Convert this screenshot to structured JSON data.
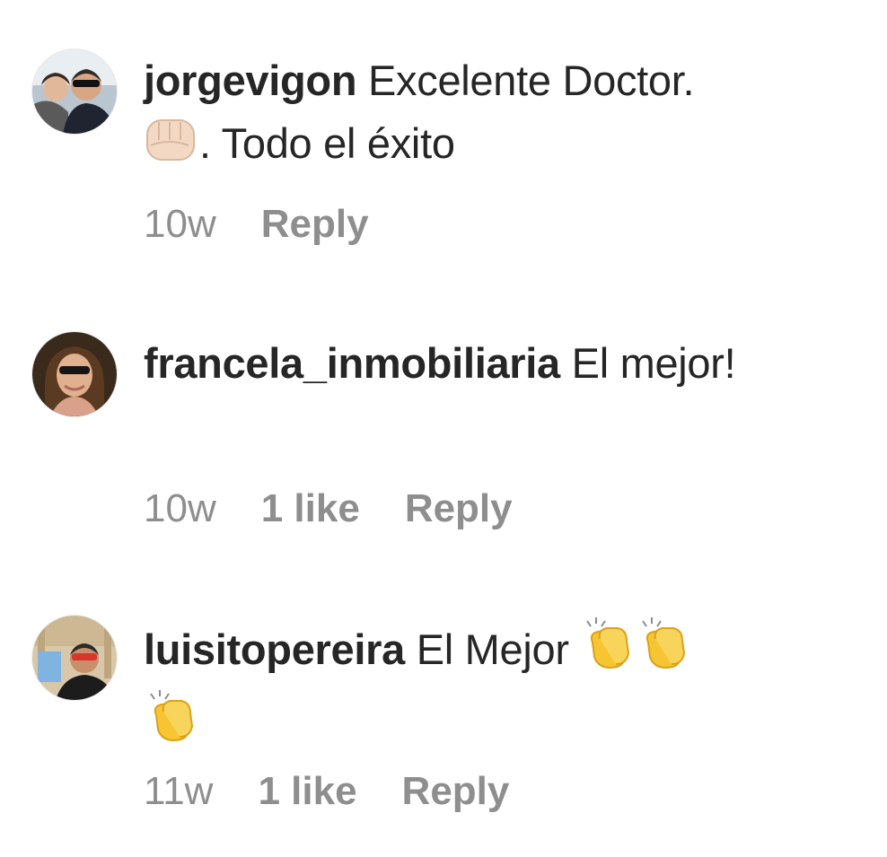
{
  "comments": [
    {
      "username": "jorgevigon",
      "text_line1": "Excelente Doctor.",
      "emoji": "fist-bump-emoji",
      "text_line2": ". Todo el éxito",
      "time": "10w",
      "likes": "",
      "reply_label": "Reply"
    },
    {
      "username": "francela_inmobiliaria",
      "text": "El mejor!",
      "time": "10w",
      "likes": "1 like",
      "reply_label": "Reply"
    },
    {
      "username": "luisitopereira",
      "text": "El Mejor",
      "emoji": "clapping-hands-emoji",
      "time": "11w",
      "likes": "1 like",
      "reply_label": "Reply"
    }
  ],
  "colors": {
    "text": "#262626",
    "meta": "#8e8e8e",
    "emoji_yellow": "#f7c531",
    "emoji_skin_light": "#f3d9c4"
  }
}
